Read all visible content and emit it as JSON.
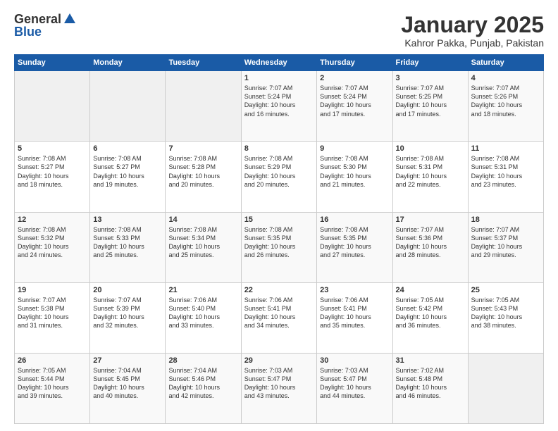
{
  "header": {
    "logo_general": "General",
    "logo_blue": "Blue",
    "title": "January 2025",
    "subtitle": "Kahror Pakka, Punjab, Pakistan"
  },
  "calendar": {
    "days_of_week": [
      "Sunday",
      "Monday",
      "Tuesday",
      "Wednesday",
      "Thursday",
      "Friday",
      "Saturday"
    ],
    "weeks": [
      [
        {
          "day": "",
          "info": ""
        },
        {
          "day": "",
          "info": ""
        },
        {
          "day": "",
          "info": ""
        },
        {
          "day": "1",
          "info": "Sunrise: 7:07 AM\nSunset: 5:24 PM\nDaylight: 10 hours\nand 16 minutes."
        },
        {
          "day": "2",
          "info": "Sunrise: 7:07 AM\nSunset: 5:24 PM\nDaylight: 10 hours\nand 17 minutes."
        },
        {
          "day": "3",
          "info": "Sunrise: 7:07 AM\nSunset: 5:25 PM\nDaylight: 10 hours\nand 17 minutes."
        },
        {
          "day": "4",
          "info": "Sunrise: 7:07 AM\nSunset: 5:26 PM\nDaylight: 10 hours\nand 18 minutes."
        }
      ],
      [
        {
          "day": "5",
          "info": "Sunrise: 7:08 AM\nSunset: 5:27 PM\nDaylight: 10 hours\nand 18 minutes."
        },
        {
          "day": "6",
          "info": "Sunrise: 7:08 AM\nSunset: 5:27 PM\nDaylight: 10 hours\nand 19 minutes."
        },
        {
          "day": "7",
          "info": "Sunrise: 7:08 AM\nSunset: 5:28 PM\nDaylight: 10 hours\nand 20 minutes."
        },
        {
          "day": "8",
          "info": "Sunrise: 7:08 AM\nSunset: 5:29 PM\nDaylight: 10 hours\nand 20 minutes."
        },
        {
          "day": "9",
          "info": "Sunrise: 7:08 AM\nSunset: 5:30 PM\nDaylight: 10 hours\nand 21 minutes."
        },
        {
          "day": "10",
          "info": "Sunrise: 7:08 AM\nSunset: 5:31 PM\nDaylight: 10 hours\nand 22 minutes."
        },
        {
          "day": "11",
          "info": "Sunrise: 7:08 AM\nSunset: 5:31 PM\nDaylight: 10 hours\nand 23 minutes."
        }
      ],
      [
        {
          "day": "12",
          "info": "Sunrise: 7:08 AM\nSunset: 5:32 PM\nDaylight: 10 hours\nand 24 minutes."
        },
        {
          "day": "13",
          "info": "Sunrise: 7:08 AM\nSunset: 5:33 PM\nDaylight: 10 hours\nand 25 minutes."
        },
        {
          "day": "14",
          "info": "Sunrise: 7:08 AM\nSunset: 5:34 PM\nDaylight: 10 hours\nand 25 minutes."
        },
        {
          "day": "15",
          "info": "Sunrise: 7:08 AM\nSunset: 5:35 PM\nDaylight: 10 hours\nand 26 minutes."
        },
        {
          "day": "16",
          "info": "Sunrise: 7:08 AM\nSunset: 5:35 PM\nDaylight: 10 hours\nand 27 minutes."
        },
        {
          "day": "17",
          "info": "Sunrise: 7:07 AM\nSunset: 5:36 PM\nDaylight: 10 hours\nand 28 minutes."
        },
        {
          "day": "18",
          "info": "Sunrise: 7:07 AM\nSunset: 5:37 PM\nDaylight: 10 hours\nand 29 minutes."
        }
      ],
      [
        {
          "day": "19",
          "info": "Sunrise: 7:07 AM\nSunset: 5:38 PM\nDaylight: 10 hours\nand 31 minutes."
        },
        {
          "day": "20",
          "info": "Sunrise: 7:07 AM\nSunset: 5:39 PM\nDaylight: 10 hours\nand 32 minutes."
        },
        {
          "day": "21",
          "info": "Sunrise: 7:06 AM\nSunset: 5:40 PM\nDaylight: 10 hours\nand 33 minutes."
        },
        {
          "day": "22",
          "info": "Sunrise: 7:06 AM\nSunset: 5:41 PM\nDaylight: 10 hours\nand 34 minutes."
        },
        {
          "day": "23",
          "info": "Sunrise: 7:06 AM\nSunset: 5:41 PM\nDaylight: 10 hours\nand 35 minutes."
        },
        {
          "day": "24",
          "info": "Sunrise: 7:05 AM\nSunset: 5:42 PM\nDaylight: 10 hours\nand 36 minutes."
        },
        {
          "day": "25",
          "info": "Sunrise: 7:05 AM\nSunset: 5:43 PM\nDaylight: 10 hours\nand 38 minutes."
        }
      ],
      [
        {
          "day": "26",
          "info": "Sunrise: 7:05 AM\nSunset: 5:44 PM\nDaylight: 10 hours\nand 39 minutes."
        },
        {
          "day": "27",
          "info": "Sunrise: 7:04 AM\nSunset: 5:45 PM\nDaylight: 10 hours\nand 40 minutes."
        },
        {
          "day": "28",
          "info": "Sunrise: 7:04 AM\nSunset: 5:46 PM\nDaylight: 10 hours\nand 42 minutes."
        },
        {
          "day": "29",
          "info": "Sunrise: 7:03 AM\nSunset: 5:47 PM\nDaylight: 10 hours\nand 43 minutes."
        },
        {
          "day": "30",
          "info": "Sunrise: 7:03 AM\nSunset: 5:47 PM\nDaylight: 10 hours\nand 44 minutes."
        },
        {
          "day": "31",
          "info": "Sunrise: 7:02 AM\nSunset: 5:48 PM\nDaylight: 10 hours\nand 46 minutes."
        },
        {
          "day": "",
          "info": ""
        }
      ]
    ]
  }
}
